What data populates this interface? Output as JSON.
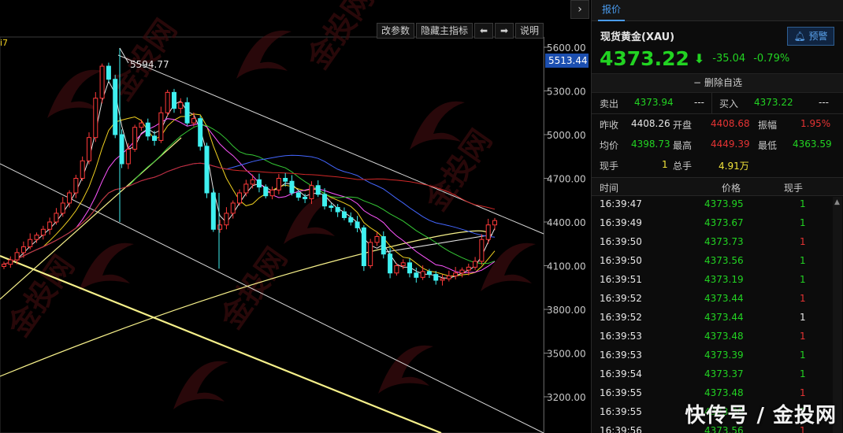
{
  "toolbar": {
    "change_params": "改参数",
    "hide_indicator": "隐藏主指标",
    "left_arrow": "⬅",
    "right_arrow": "➡",
    "explain": "说明"
  },
  "chart": {
    "top_left_fragment": "i7",
    "peak_label": "5594.77",
    "current_price_tag": "5513.44"
  },
  "chart_data": {
    "type": "candlestick",
    "y_axis": {
      "ticks": [
        5600,
        5300,
        5000,
        4700,
        4400,
        4100,
        3800,
        3500,
        3200
      ],
      "tick_labels": [
        "5600.00",
        "5300.00",
        "5000.00",
        "4700.00",
        "4400.00",
        "4100.00",
        "3800.00",
        "3500.00",
        "3200.00"
      ],
      "ylim": [
        3200,
        5600
      ]
    },
    "peak_high": 5594.77,
    "price_path": [
      4110,
      4140,
      4190,
      4230,
      4280,
      4310,
      4350,
      4400,
      4460,
      4530,
      4600,
      4700,
      4820,
      4980,
      5250,
      5470,
      5380,
      5000,
      4800,
      4900,
      5050,
      5080,
      4990,
      4960,
      5150,
      5290,
      5180,
      5220,
      5080,
      5110,
      4920,
      4600,
      4350,
      4380,
      4460,
      4530,
      4600,
      4660,
      4690,
      4640,
      4580,
      4620,
      4700,
      4680,
      4600,
      4570,
      4560,
      4650,
      4590,
      4510,
      4500,
      4470,
      4430,
      4400,
      4360,
      4100,
      4260,
      4300,
      4180,
      4050,
      4100,
      4120,
      4050,
      4020,
      4060,
      4040,
      4000,
      4010,
      4030,
      4050,
      4070,
      4090,
      4130,
      4280,
      4380,
      4410
    ]
  },
  "panel": {
    "tab": "报价",
    "name": "现货黄金(XAU)",
    "alert_label": "预警",
    "last_price": "4373.22",
    "change": "-35.04",
    "change_pct": "-0.79%",
    "watchlist_action": "删除自选",
    "sell_label": "卖出",
    "sell_price": "4373.94",
    "sell_qty": "---",
    "buy_label": "买入",
    "buy_price": "4373.22",
    "buy_qty": "---",
    "prev_close_label": "昨收",
    "prev_close": "4408.26",
    "open_label": "开盘",
    "open": "4408.68",
    "amplitude_label": "振幅",
    "amplitude": "1.95%",
    "avg_label": "均价",
    "avg": "4398.73",
    "high_label": "最高",
    "high": "4449.39",
    "low_label": "最低",
    "low": "4363.59",
    "cur_vol_label": "现手",
    "cur_vol": "1",
    "total_vol_label": "总手",
    "total_vol": "4.91万"
  },
  "ticks": {
    "header_time": "时间",
    "header_price": "价格",
    "header_vol": "现手",
    "rows": [
      {
        "time": "16:39:47",
        "price": "4373.95",
        "vol": "1",
        "dir": "up"
      },
      {
        "time": "16:39:49",
        "price": "4373.67",
        "vol": "1",
        "dir": "up"
      },
      {
        "time": "16:39:50",
        "price": "4373.73",
        "vol": "1",
        "dir": "down"
      },
      {
        "time": "16:39:50",
        "price": "4373.56",
        "vol": "1",
        "dir": "up"
      },
      {
        "time": "16:39:51",
        "price": "4373.19",
        "vol": "1",
        "dir": "up"
      },
      {
        "time": "16:39:52",
        "price": "4373.44",
        "vol": "1",
        "dir": "down"
      },
      {
        "time": "16:39:52",
        "price": "4373.44",
        "vol": "1",
        "dir": "flat"
      },
      {
        "time": "16:39:53",
        "price": "4373.48",
        "vol": "1",
        "dir": "down"
      },
      {
        "time": "16:39:53",
        "price": "4373.39",
        "vol": "1",
        "dir": "up"
      },
      {
        "time": "16:39:54",
        "price": "4373.37",
        "vol": "1",
        "dir": "up"
      },
      {
        "time": "16:39:55",
        "price": "4373.48",
        "vol": "1",
        "dir": "down"
      },
      {
        "time": "16:39:55",
        "price": "4373.30",
        "vol": "1",
        "dir": "up"
      },
      {
        "time": "16:39:56",
        "price": "4373.56",
        "vol": "1",
        "dir": "down"
      }
    ]
  },
  "watermark": "快传号 / 金投网"
}
